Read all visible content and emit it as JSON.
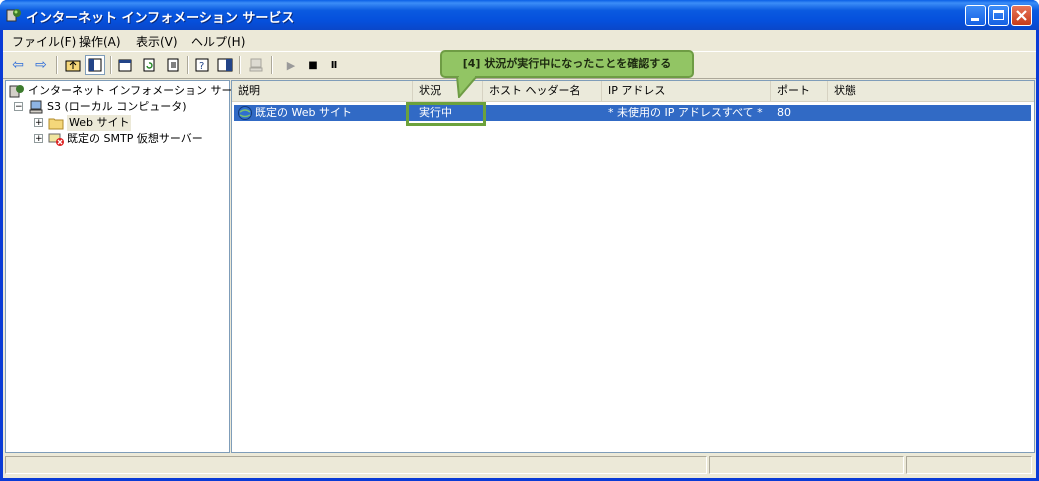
{
  "window": {
    "title": "インターネット インフォメーション サービス",
    "buttons": {
      "minimize": "_",
      "maximize": "□",
      "close": "×"
    }
  },
  "menu": [
    {
      "label": "ファイル(F)"
    },
    {
      "label": "操作(A)"
    },
    {
      "label": "表示(V)"
    },
    {
      "label": "ヘルプ(H)"
    }
  ],
  "toolbar": {
    "back_icon": "⇦",
    "forward_icon": "⇨",
    "play_icon": "▶",
    "stop_icon": "■",
    "pause_icon": "Ⅱ"
  },
  "tree": {
    "root": "インターネット インフォメーション サービス",
    "computer": "S3 (ローカル コンピュータ)",
    "web_sites": "Web サイト",
    "smtp": "既定の SMTP 仮想サーバー",
    "expand_minus": "−",
    "expand_plus": "+"
  },
  "list": {
    "columns": [
      "説明",
      "状況",
      "ホスト ヘッダー名",
      "IP アドレス",
      "ポート",
      "状態"
    ],
    "rows": [
      {
        "description": "既定の Web サイト",
        "status": "実行中",
        "host_header": "",
        "ip": "* 未使用の IP アドレスすべて *",
        "port": "80",
        "state": ""
      }
    ]
  },
  "callout": {
    "text": "[4]  状況が実行中になったことを確認する"
  },
  "colors": {
    "titlebar": "#0a5ae0",
    "selection": "#316ac5",
    "callout_fill": "#92c564",
    "highlight_border": "#6ca23c"
  }
}
